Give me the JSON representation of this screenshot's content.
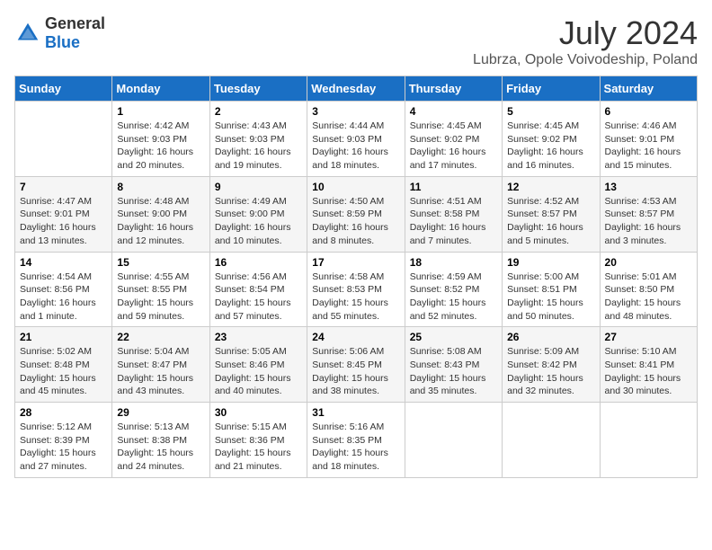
{
  "logo": {
    "general": "General",
    "blue": "Blue"
  },
  "header": {
    "month_year": "July 2024",
    "location": "Lubrza, Opole Voivodeship, Poland"
  },
  "weekdays": [
    "Sunday",
    "Monday",
    "Tuesday",
    "Wednesday",
    "Thursday",
    "Friday",
    "Saturday"
  ],
  "weeks": [
    [
      {
        "day": "",
        "info": ""
      },
      {
        "day": "1",
        "info": "Sunrise: 4:42 AM\nSunset: 9:03 PM\nDaylight: 16 hours\nand 20 minutes."
      },
      {
        "day": "2",
        "info": "Sunrise: 4:43 AM\nSunset: 9:03 PM\nDaylight: 16 hours\nand 19 minutes."
      },
      {
        "day": "3",
        "info": "Sunrise: 4:44 AM\nSunset: 9:03 PM\nDaylight: 16 hours\nand 18 minutes."
      },
      {
        "day": "4",
        "info": "Sunrise: 4:45 AM\nSunset: 9:02 PM\nDaylight: 16 hours\nand 17 minutes."
      },
      {
        "day": "5",
        "info": "Sunrise: 4:45 AM\nSunset: 9:02 PM\nDaylight: 16 hours\nand 16 minutes."
      },
      {
        "day": "6",
        "info": "Sunrise: 4:46 AM\nSunset: 9:01 PM\nDaylight: 16 hours\nand 15 minutes."
      }
    ],
    [
      {
        "day": "7",
        "info": "Sunrise: 4:47 AM\nSunset: 9:01 PM\nDaylight: 16 hours\nand 13 minutes."
      },
      {
        "day": "8",
        "info": "Sunrise: 4:48 AM\nSunset: 9:00 PM\nDaylight: 16 hours\nand 12 minutes."
      },
      {
        "day": "9",
        "info": "Sunrise: 4:49 AM\nSunset: 9:00 PM\nDaylight: 16 hours\nand 10 minutes."
      },
      {
        "day": "10",
        "info": "Sunrise: 4:50 AM\nSunset: 8:59 PM\nDaylight: 16 hours\nand 8 minutes."
      },
      {
        "day": "11",
        "info": "Sunrise: 4:51 AM\nSunset: 8:58 PM\nDaylight: 16 hours\nand 7 minutes."
      },
      {
        "day": "12",
        "info": "Sunrise: 4:52 AM\nSunset: 8:57 PM\nDaylight: 16 hours\nand 5 minutes."
      },
      {
        "day": "13",
        "info": "Sunrise: 4:53 AM\nSunset: 8:57 PM\nDaylight: 16 hours\nand 3 minutes."
      }
    ],
    [
      {
        "day": "14",
        "info": "Sunrise: 4:54 AM\nSunset: 8:56 PM\nDaylight: 16 hours\nand 1 minute."
      },
      {
        "day": "15",
        "info": "Sunrise: 4:55 AM\nSunset: 8:55 PM\nDaylight: 15 hours\nand 59 minutes."
      },
      {
        "day": "16",
        "info": "Sunrise: 4:56 AM\nSunset: 8:54 PM\nDaylight: 15 hours\nand 57 minutes."
      },
      {
        "day": "17",
        "info": "Sunrise: 4:58 AM\nSunset: 8:53 PM\nDaylight: 15 hours\nand 55 minutes."
      },
      {
        "day": "18",
        "info": "Sunrise: 4:59 AM\nSunset: 8:52 PM\nDaylight: 15 hours\nand 52 minutes."
      },
      {
        "day": "19",
        "info": "Sunrise: 5:00 AM\nSunset: 8:51 PM\nDaylight: 15 hours\nand 50 minutes."
      },
      {
        "day": "20",
        "info": "Sunrise: 5:01 AM\nSunset: 8:50 PM\nDaylight: 15 hours\nand 48 minutes."
      }
    ],
    [
      {
        "day": "21",
        "info": "Sunrise: 5:02 AM\nSunset: 8:48 PM\nDaylight: 15 hours\nand 45 minutes."
      },
      {
        "day": "22",
        "info": "Sunrise: 5:04 AM\nSunset: 8:47 PM\nDaylight: 15 hours\nand 43 minutes."
      },
      {
        "day": "23",
        "info": "Sunrise: 5:05 AM\nSunset: 8:46 PM\nDaylight: 15 hours\nand 40 minutes."
      },
      {
        "day": "24",
        "info": "Sunrise: 5:06 AM\nSunset: 8:45 PM\nDaylight: 15 hours\nand 38 minutes."
      },
      {
        "day": "25",
        "info": "Sunrise: 5:08 AM\nSunset: 8:43 PM\nDaylight: 15 hours\nand 35 minutes."
      },
      {
        "day": "26",
        "info": "Sunrise: 5:09 AM\nSunset: 8:42 PM\nDaylight: 15 hours\nand 32 minutes."
      },
      {
        "day": "27",
        "info": "Sunrise: 5:10 AM\nSunset: 8:41 PM\nDaylight: 15 hours\nand 30 minutes."
      }
    ],
    [
      {
        "day": "28",
        "info": "Sunrise: 5:12 AM\nSunset: 8:39 PM\nDaylight: 15 hours\nand 27 minutes."
      },
      {
        "day": "29",
        "info": "Sunrise: 5:13 AM\nSunset: 8:38 PM\nDaylight: 15 hours\nand 24 minutes."
      },
      {
        "day": "30",
        "info": "Sunrise: 5:15 AM\nSunset: 8:36 PM\nDaylight: 15 hours\nand 21 minutes."
      },
      {
        "day": "31",
        "info": "Sunrise: 5:16 AM\nSunset: 8:35 PM\nDaylight: 15 hours\nand 18 minutes."
      },
      {
        "day": "",
        "info": ""
      },
      {
        "day": "",
        "info": ""
      },
      {
        "day": "",
        "info": ""
      }
    ]
  ]
}
